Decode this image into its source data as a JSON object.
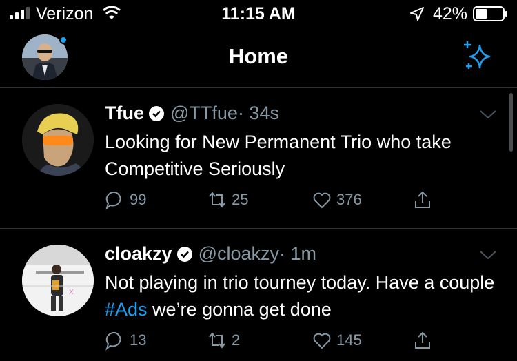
{
  "status_bar": {
    "carrier": "Verizon",
    "time": "11:15 AM",
    "battery": "42%"
  },
  "header": {
    "title": "Home"
  },
  "tweets": [
    {
      "name": "Tfue",
      "handle": "@TTfue",
      "time": "· 34s",
      "text": "Looking for New Permanent Trio who take Competitive Seriously",
      "replies": "99",
      "retweets": "25",
      "likes": "376"
    },
    {
      "name": "cloakzy",
      "handle": "@cloakzy",
      "time": "· 1m",
      "text_before": "Not playing in trio tourney today. Have a couple ",
      "hashtag": "#Ads",
      "text_after": " we’re gonna get done",
      "replies": "13",
      "retweets": "2",
      "likes": "145"
    }
  ],
  "colors": {
    "accent": "#1da1f2",
    "muted": "#8899a6",
    "divider": "#2f3336",
    "background": "#000000"
  },
  "icons": [
    "signal-icon",
    "wifi-icon",
    "location-icon",
    "battery-icon",
    "sparkle-icon",
    "verified-icon",
    "chevron-down-icon",
    "reply-icon",
    "retweet-icon",
    "like-icon",
    "share-icon"
  ]
}
